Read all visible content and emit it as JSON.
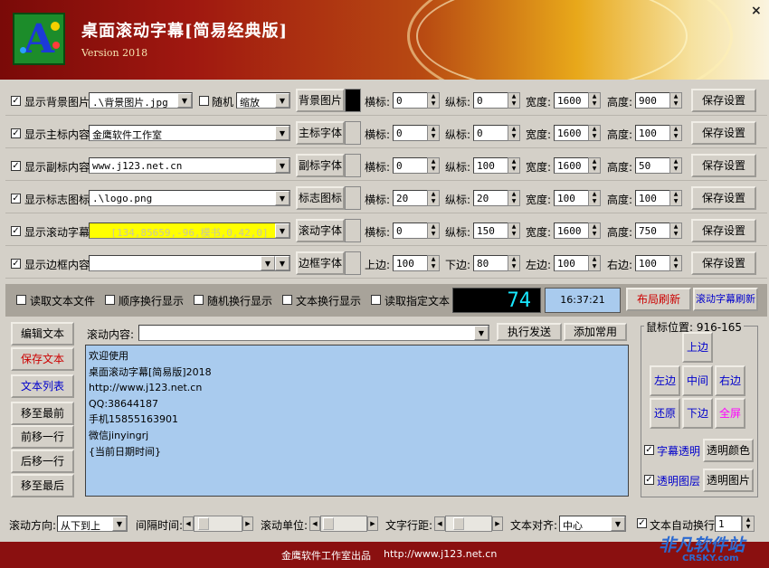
{
  "header": {
    "title": "桌面滚动字幕[简易经典版]",
    "version": "Version 2018",
    "close_label": "×"
  },
  "rows": [
    {
      "check": "显示背景图片",
      "value": ".\\背景图片.jpg",
      "random_label": "随机",
      "scale": "缩放",
      "button": "背景图片",
      "swatch": "#000000",
      "f1": "横标:",
      "v1": "0",
      "f2": "纵标:",
      "v2": "0",
      "f3": "宽度:",
      "v3": "1600",
      "f4": "高度:",
      "v4": "900",
      "save": "保存设置"
    },
    {
      "check": "显示主标内容",
      "value": "金鹰软件工作室",
      "button": "主标字体",
      "swatch": "#d4d0c8",
      "f1": "横标:",
      "v1": "0",
      "f2": "纵标:",
      "v2": "0",
      "f3": "宽度:",
      "v3": "1600",
      "f4": "高度:",
      "v4": "100",
      "save": "保存设置"
    },
    {
      "check": "显示副标内容",
      "value": "www.j123.net.cn",
      "button": "副标字体",
      "swatch": "#d4d0c8",
      "f1": "横标:",
      "v1": "0",
      "f2": "纵标:",
      "v2": "100",
      "f3": "宽度:",
      "v3": "1600",
      "f4": "高度:",
      "v4": "50",
      "save": "保存设置"
    },
    {
      "check": "显示标志图标",
      "value": ".\\logo.png",
      "button": "标志图标",
      "swatch": "#d4d0c8",
      "f1": "横标:",
      "v1": "20",
      "f2": "纵标:",
      "v2": "20",
      "f3": "宽度:",
      "v3": "100",
      "f4": "高度:",
      "v4": "100",
      "save": "保存设置"
    },
    {
      "check": "显示滚动字幕",
      "value": "[134,85659,-96,模书,0,42,0]",
      "button": "滚动字体",
      "swatch": "#d4d0c8",
      "f1": "横标:",
      "v1": "0",
      "f2": "纵标:",
      "v2": "150",
      "f3": "宽度:",
      "v3": "1600",
      "f4": "高度:",
      "v4": "750",
      "save": "保存设置"
    },
    {
      "check": "显示边框内容",
      "value": "",
      "button": "边框字体",
      "swatch": "#d4d0c8",
      "f1": "上边:",
      "v1": "100",
      "f2": "下边:",
      "v2": "80",
      "f3": "左边:",
      "v3": "100",
      "f4": "右边:",
      "v4": "100",
      "save": "保存设置"
    }
  ],
  "midbar": {
    "opts": [
      "读取文本文件",
      "顺序换行显示",
      "随机换行显示",
      "文本换行显示",
      "读取指定文本"
    ],
    "counter": "74",
    "clock": "16:37:21",
    "layout_refresh": "布局刷新",
    "scroll_refresh": "滚动字幕刷新"
  },
  "sidebar": [
    "编辑文本",
    "保存文本",
    "文本列表",
    "移至最前",
    "前移一行",
    "后移一行",
    "移至最后"
  ],
  "content": {
    "label": "滚动内容:",
    "value": "",
    "send": "执行发送",
    "add": "添加常用",
    "lines": [
      "欢迎使用",
      "桌面滚动字幕[简易版]2018",
      "http://www.j123.net.cn",
      "QQ:38644187",
      "手机15855163901",
      "微信jinyingrj",
      "{当前日期时间}"
    ]
  },
  "position": {
    "label": "鼠标位置: 916-165",
    "up": "上边",
    "left": "左边",
    "center": "中间",
    "right": "右边",
    "reset": "还原",
    "down": "下边",
    "full": "全屏",
    "transparent_label": "字幕透明",
    "color_btn": "透明颜色",
    "layer_label": "透明图层",
    "image_btn": "透明图片"
  },
  "bottom": {
    "dir_label": "滚动方向:",
    "dir_value": "从下到上",
    "interval_label": "间隔时间:",
    "unit_label": "滚动单位:",
    "spacing_label": "文字行距:",
    "align_label": "文本对齐:",
    "align_value": "中心",
    "wrap_label": "文本自动换行",
    "wrap_value": "1"
  },
  "footer": {
    "text": "金鹰软件工作室出品",
    "url": "http://www.j123.net.cn"
  },
  "watermark": {
    "title": "非凡软件站",
    "sub": "CRSKY.com"
  },
  "colors": {
    "header_dark": "#7a0a08",
    "footer": "#8a1010",
    "text_area": "#a9cbee",
    "highlight": "#ffff00",
    "red_text": "#cc0000",
    "blue_text": "#0000cc",
    "magenta": "#ff00ff"
  }
}
